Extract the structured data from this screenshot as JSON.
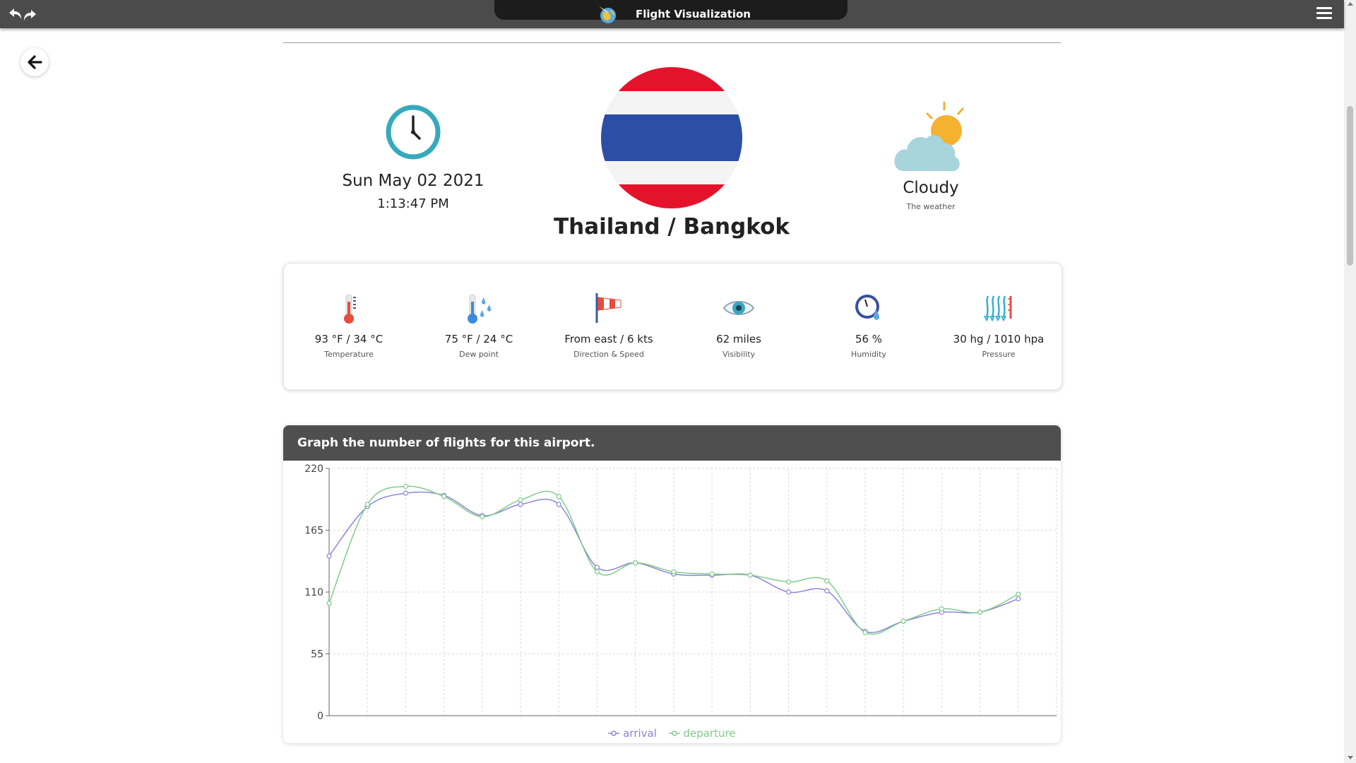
{
  "app": {
    "title": "Flight Visualization"
  },
  "location": {
    "date": "Sun May 02 2021",
    "time": "1:13:47 PM",
    "name": "Thailand / Bangkok"
  },
  "weather": {
    "label": "Cloudy",
    "sub": "The weather"
  },
  "stats": [
    {
      "icon": "thermometer-icon",
      "value": "93 °F / 34 °C",
      "label": "Temperature"
    },
    {
      "icon": "dew-point-icon",
      "value": "75 °F / 24 °C",
      "label": "Dew point"
    },
    {
      "icon": "windsock-icon",
      "value": "From east / 6 kts",
      "label": "Direction & Speed"
    },
    {
      "icon": "eye-icon",
      "value": "62 miles",
      "label": "Visibility"
    },
    {
      "icon": "humidity-gauge-icon",
      "value": "56 %",
      "label": "Humidity"
    },
    {
      "icon": "pressure-icon",
      "value": "30 hg / 1010 hpa",
      "label": "Pressure"
    }
  ],
  "graph": {
    "title": "Graph the number of flights for this airport."
  },
  "colors": {
    "arrival": "#8b84d8",
    "departure": "#7fcc8a",
    "topbar": "#4b4b4b",
    "flag_red": "#e4132c",
    "flag_blue": "#2b4fa5"
  },
  "chart_data": {
    "type": "line",
    "ylim": [
      0,
      220
    ],
    "yticks": [
      0,
      55,
      110,
      165,
      220
    ],
    "x": [
      1,
      2,
      3,
      4,
      5,
      6,
      7,
      8,
      9,
      10,
      11,
      12,
      13,
      14,
      15,
      16,
      17,
      18,
      19,
      20
    ],
    "grid": true,
    "legend": "bottom-center",
    "series": [
      {
        "name": "arrival",
        "values": [
          142,
          186,
          198,
          196,
          178,
          188,
          188,
          132,
          136,
          126,
          125,
          125,
          110,
          111,
          75,
          84,
          92,
          92,
          104
        ]
      },
      {
        "name": "departure",
        "values": [
          100,
          188,
          204,
          195,
          177,
          192,
          195,
          128,
          136,
          128,
          126,
          125,
          119,
          120,
          74,
          84,
          95,
          92,
          108
        ]
      }
    ]
  }
}
